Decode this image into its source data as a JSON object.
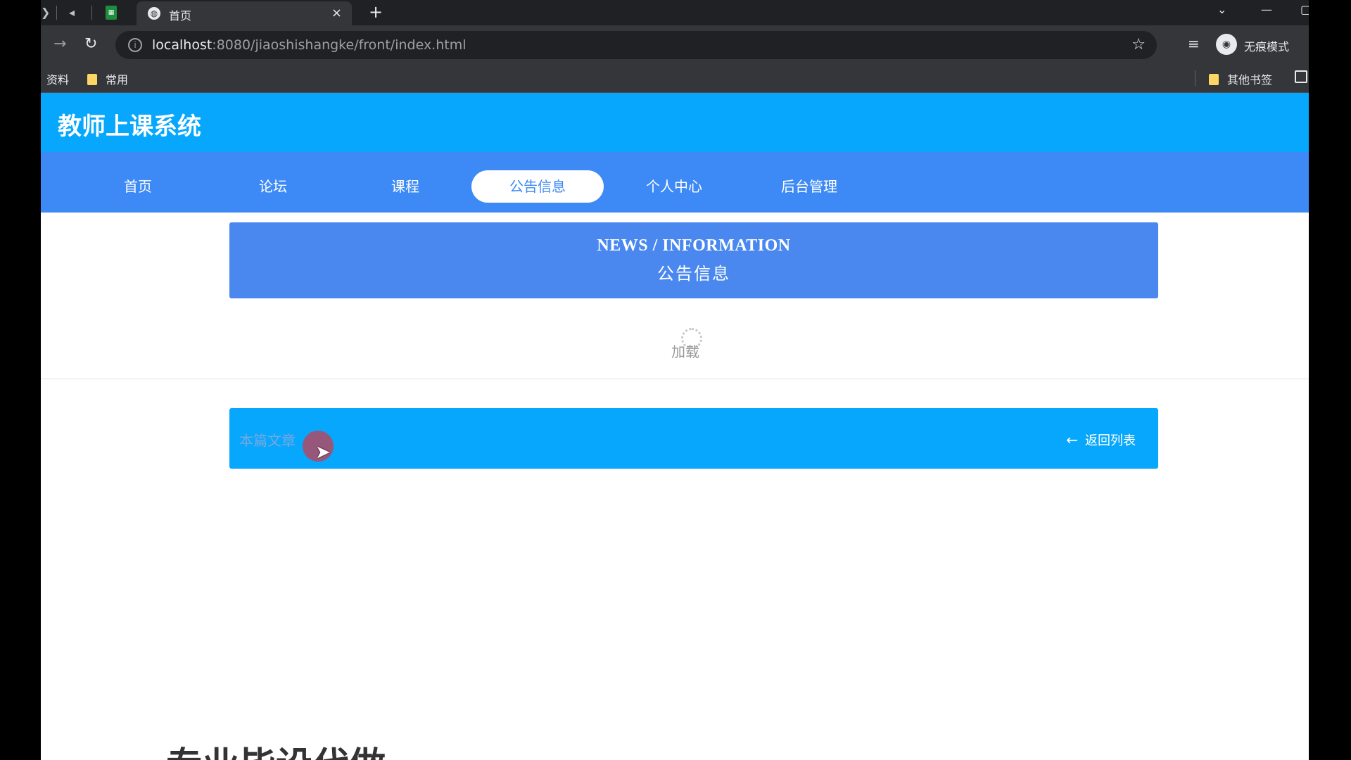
{
  "browser": {
    "tab_title": "首页",
    "tab_close": "×",
    "new_tab": "+",
    "url_host": "localhost",
    "url_rest": ":8080/jiaoshishangke/front/index.html",
    "incognito_label": "无痕模式",
    "bookmarks": [
      "资料",
      "常用"
    ],
    "other_bookmarks": "其他书签"
  },
  "site": {
    "title": "教师上课系统",
    "nav": [
      {
        "label": "首页",
        "active": false
      },
      {
        "label": "论坛",
        "active": false
      },
      {
        "label": "课程",
        "active": false
      },
      {
        "label": "公告信息",
        "active": true
      },
      {
        "label": "个人中心",
        "active": false
      },
      {
        "label": "后台管理",
        "active": false
      }
    ]
  },
  "banner": {
    "en": "NEWS / INFORMATION",
    "cn": "公告信息"
  },
  "loading_text": "加载",
  "detail": {
    "title": "本篇文章",
    "back_label": "返回列表",
    "back_icon": "arrow-left-icon"
  },
  "article": {
    "heading": "专业毕设代做"
  },
  "colors": {
    "header": "#06a7fc",
    "nav": "#3d8af7",
    "banner": "#4a88f0"
  }
}
